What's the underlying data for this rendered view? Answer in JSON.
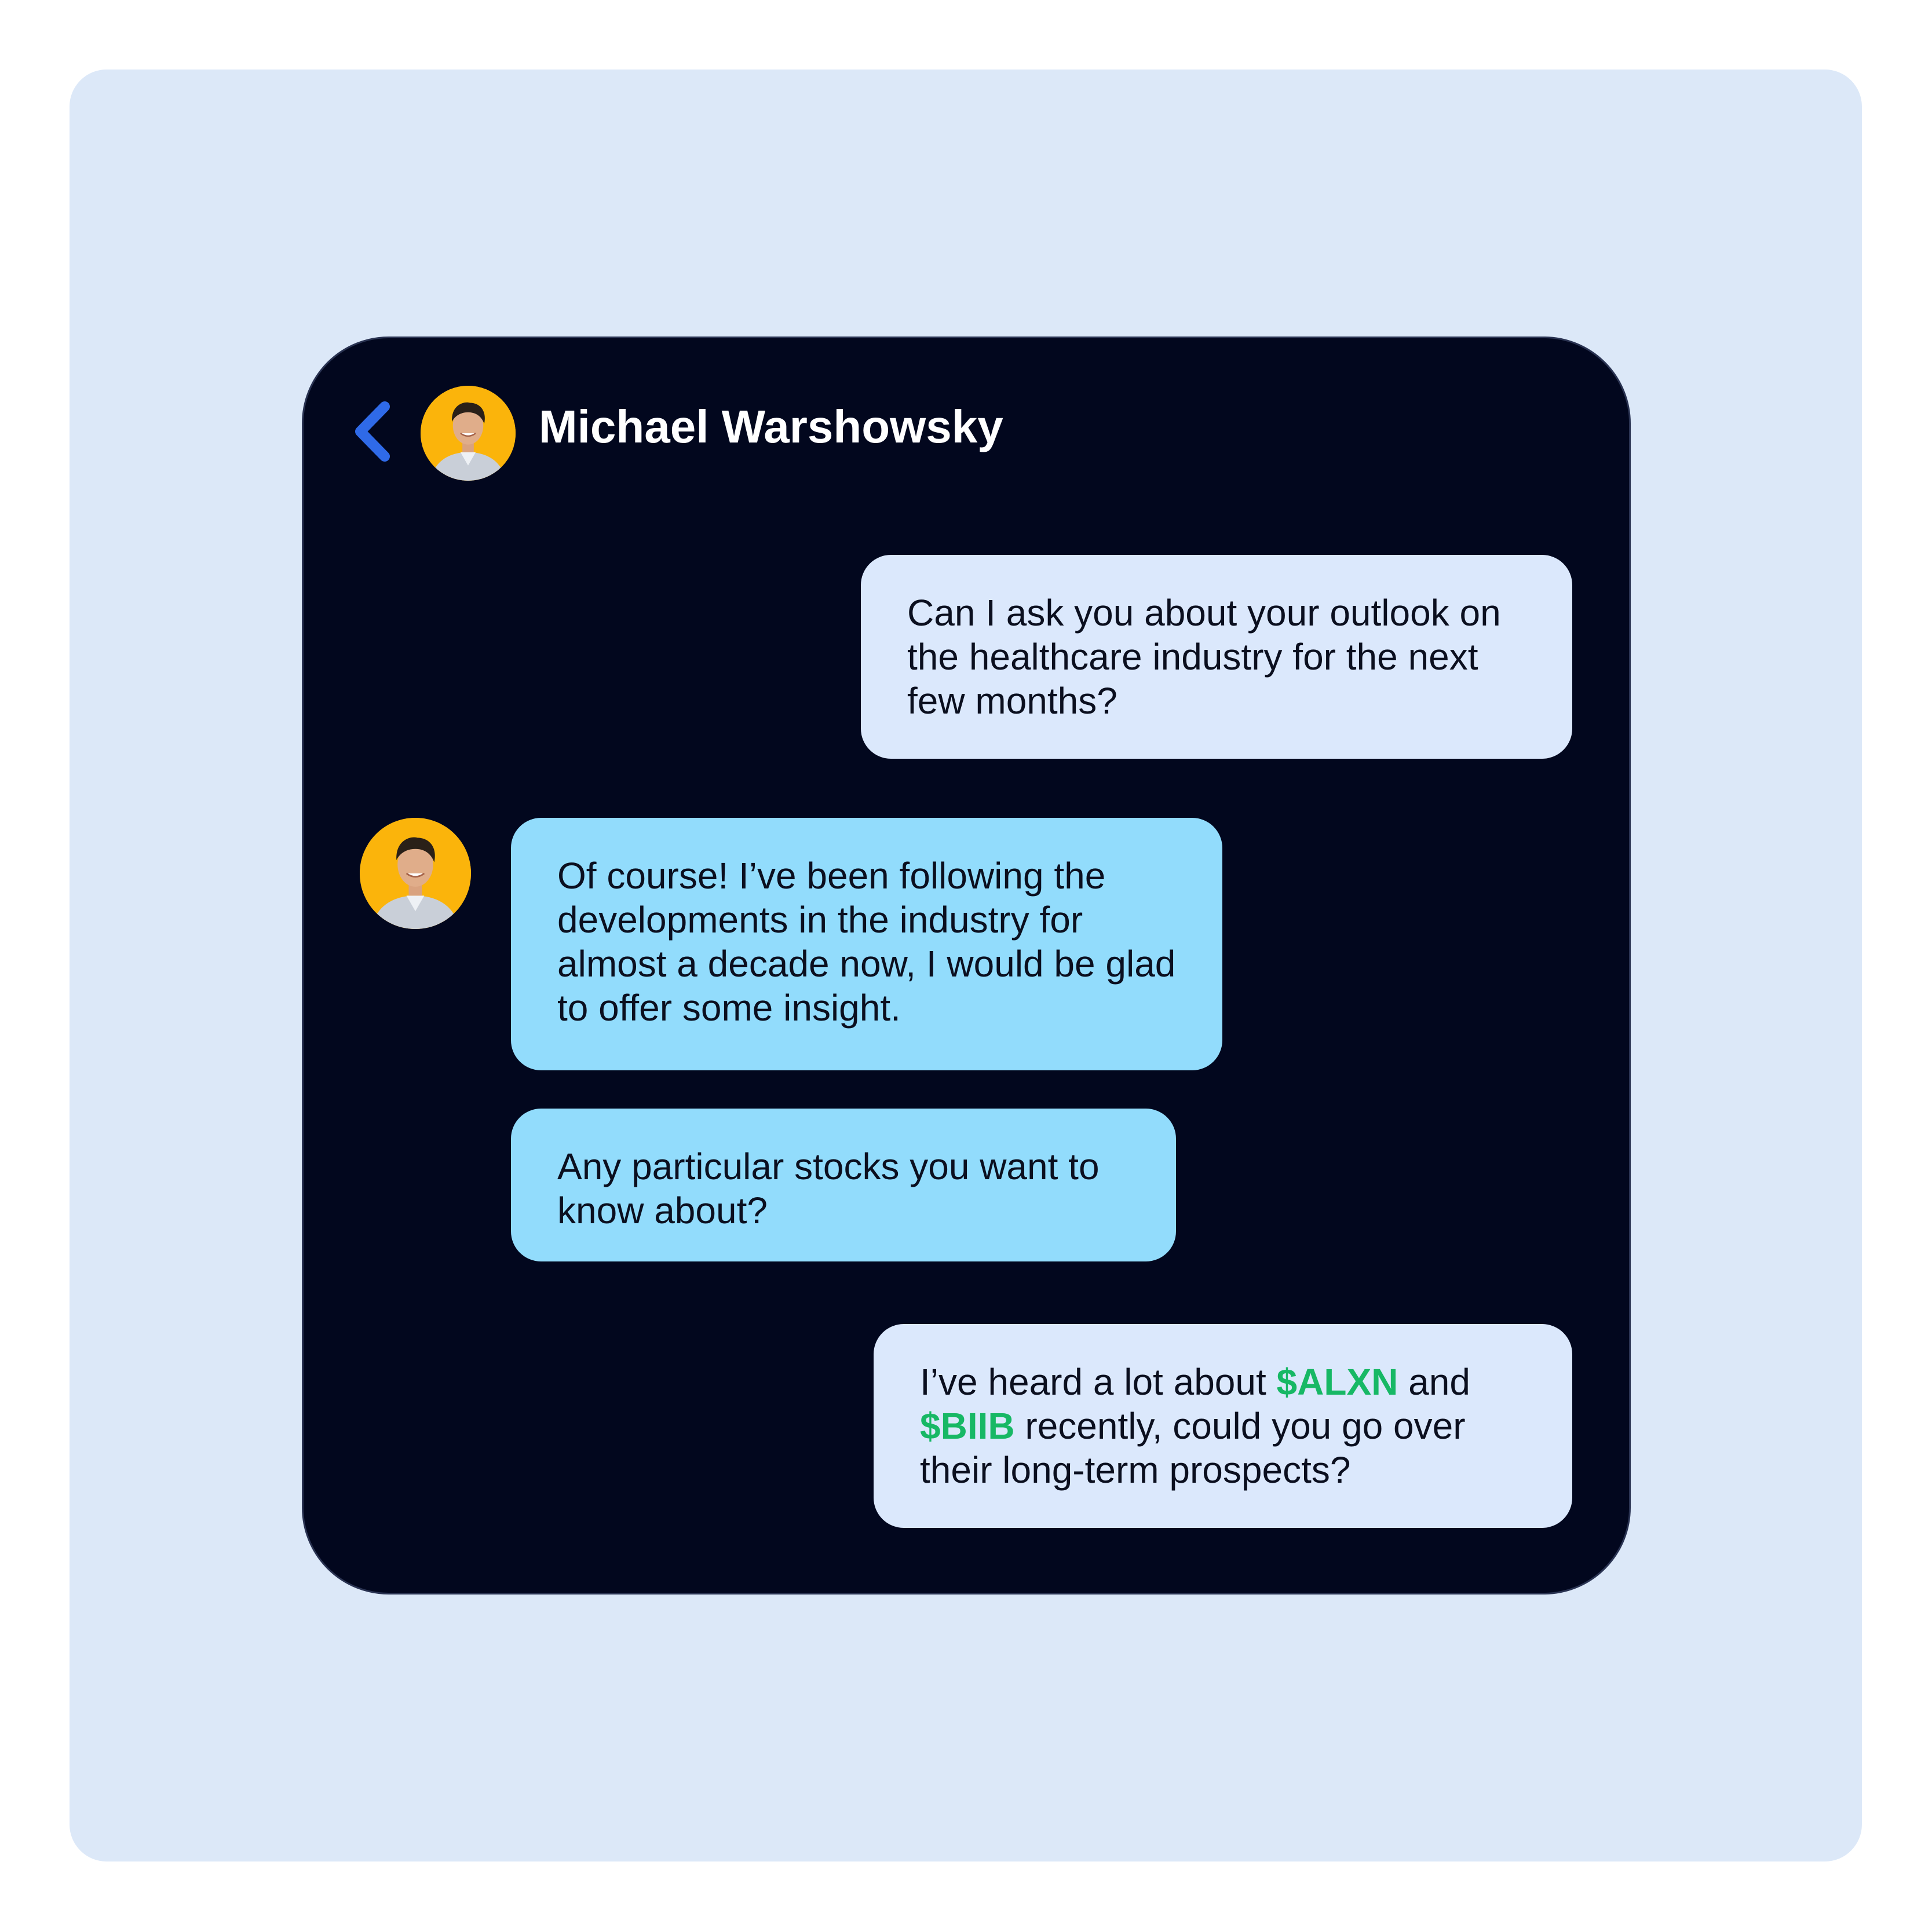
{
  "header": {
    "contact_name": "Michael Warshowsky",
    "back_icon": "chevron-left-icon",
    "avatar_icon": "person-avatar-icon"
  },
  "messages": [
    {
      "side": "outgoing",
      "text": "Can I ask you about your outlook on the healthcare industry for the next few months?"
    },
    {
      "side": "incoming",
      "text": "Of course! I’ve been following the developments in the industry for almost a decade now, I would be glad to offer some insight."
    },
    {
      "side": "incoming",
      "text": "Any particular stocks you want to know about?"
    },
    {
      "side": "outgoing",
      "parts": {
        "p1": "I’ve heard a lot about ",
        "ticker1": "$ALXN",
        "p2": " and ",
        "ticker2": "$BIIB",
        "p3": " recently, could you go over their long-term prospects?"
      }
    }
  ],
  "colors": {
    "page_background": "#dce8f8",
    "chat_background": "#02071e",
    "outgoing_bubble": "#dbe8fc",
    "incoming_bubble": "#92dcfc",
    "ticker": "#17b865",
    "back_icon": "#2f6ae8",
    "avatar_background": "#fbb40b"
  }
}
